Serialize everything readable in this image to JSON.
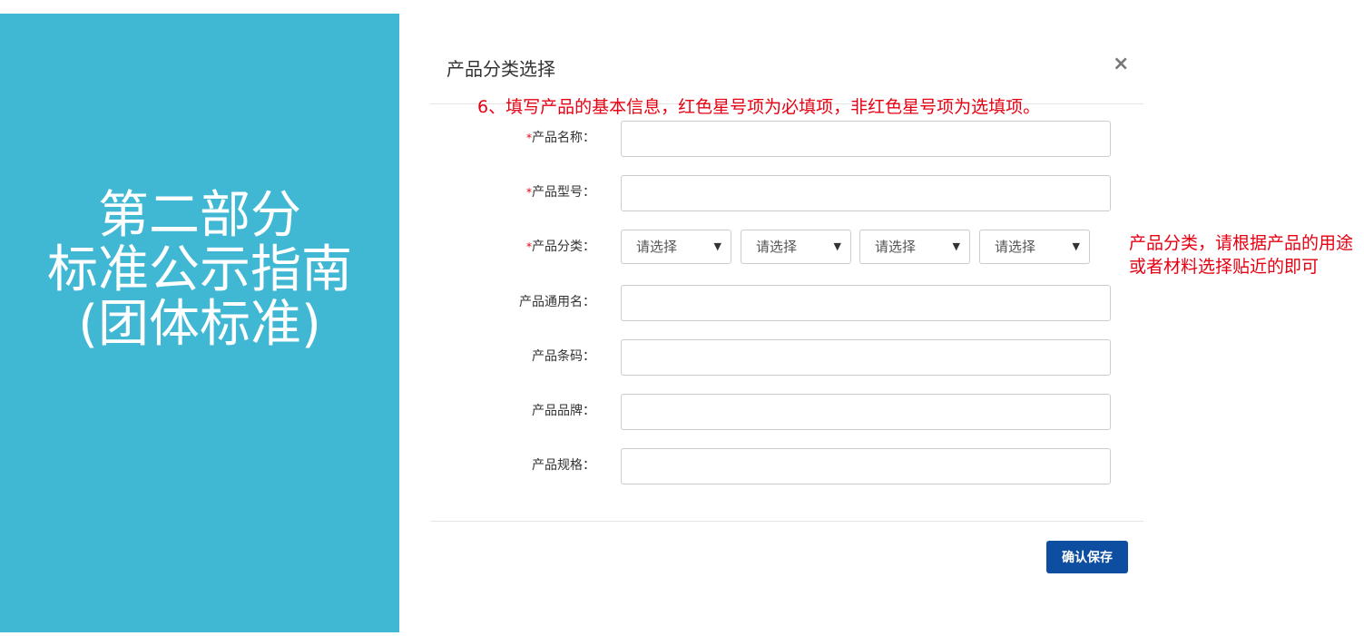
{
  "side_panel": {
    "title_lines": [
      "第二部分",
      "标准公示指南",
      "(团体标准)"
    ]
  },
  "modal": {
    "title": "产品分类选择",
    "close_label": "×"
  },
  "annotations": {
    "top": "6、填写产品的基本信息，红色星号项为必填项，非红色星号项为选填项。",
    "side": "产品分类，请根据产品的用途或者材料选择贴近的即可"
  },
  "form": {
    "required_mark": "*",
    "fields": [
      {
        "label": "产品名称：",
        "required": true,
        "value": ""
      },
      {
        "label": "产品型号：",
        "required": true,
        "value": ""
      },
      {
        "label": "产品分类：",
        "required": true
      },
      {
        "label": "产品通用名：",
        "required": false,
        "value": ""
      },
      {
        "label": "产品条码：",
        "required": false,
        "value": ""
      },
      {
        "label": "产品品牌：",
        "required": false,
        "value": ""
      },
      {
        "label": "产品规格：",
        "required": false,
        "value": ""
      }
    ],
    "category_selects": [
      "请选择",
      "请选择",
      "请选择",
      "请选择"
    ],
    "select_arrow": "▼"
  },
  "footer": {
    "confirm_label": "确认保存"
  },
  "colors": {
    "side_panel": "#41b8d3",
    "annotation": "#e60012",
    "primary_button": "#0d4ea0"
  }
}
